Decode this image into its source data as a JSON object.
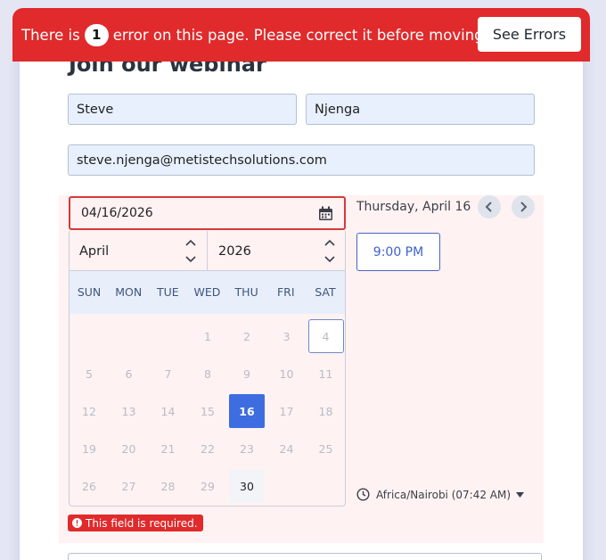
{
  "banner": {
    "text_before": "There is",
    "error_count": "1",
    "text_after": "error on this page. Please correct it before moving on.",
    "see_errors_label": "See Errors",
    "color": "#e02a2b"
  },
  "form": {
    "title": "Join our webinar",
    "first_name": "Steve",
    "last_name": "Njenga",
    "email": "steve.njenga@metistechsolutions.com"
  },
  "date_picker": {
    "value": "04/16/2026",
    "month": "April",
    "year": "2026",
    "weekdays": [
      "SUN",
      "MON",
      "TUE",
      "WED",
      "THU",
      "FRI",
      "SAT"
    ],
    "weeks": [
      [
        "",
        "",
        "",
        "1",
        "2",
        "3",
        "4"
      ],
      [
        "5",
        "6",
        "7",
        "8",
        "9",
        "10",
        "11"
      ],
      [
        "12",
        "13",
        "14",
        "15",
        "16",
        "17",
        "18"
      ],
      [
        "19",
        "20",
        "21",
        "22",
        "23",
        "24",
        "25"
      ],
      [
        "26",
        "27",
        "28",
        "29",
        "30",
        "",
        ""
      ]
    ],
    "selected_day": "16",
    "today_day": "4",
    "available_days": [
      "30"
    ],
    "accent_color": "#3d6de0",
    "error_message": "This field is required."
  },
  "time_panel": {
    "date_heading": "Thursday, April 16",
    "slots": [
      "9:00 PM"
    ],
    "timezone": "Africa/Nairobi (07:42 AM)"
  }
}
